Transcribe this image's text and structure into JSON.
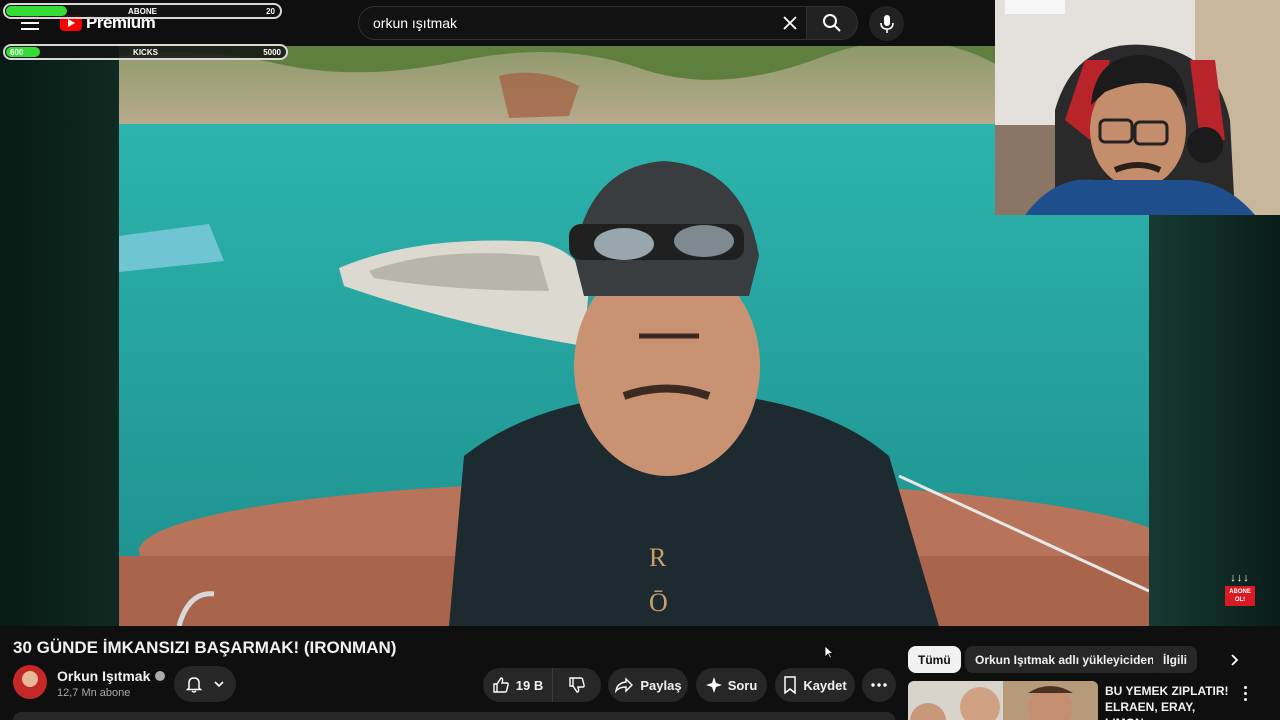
{
  "topbar": {
    "logo_text": "Premium",
    "search_query": "orkun ışıtmak"
  },
  "overlay": {
    "abone": {
      "left": "",
      "label": "ABONE",
      "right": "20",
      "fill_fraction": 0.22
    },
    "kicks": {
      "left": "600",
      "label": "KICKS",
      "right": "5000",
      "fill_fraction": 0.12
    }
  },
  "subscribe_badge": {
    "arrows": "↓↓↓",
    "line1": "ABONE",
    "line2": "OL!"
  },
  "video": {
    "title": "30 GÜNDE İMKANSIZI BAŞARMAK! (IRONMAN)",
    "channel": "Orkun Işıtmak",
    "subscribers": "12,7 Mn abone"
  },
  "actions": {
    "likes": "19 B",
    "share": "Paylaş",
    "ask": "Soru",
    "save": "Kaydet"
  },
  "sidebar": {
    "chips": [
      "Tümü",
      "Orkun Işıtmak adlı yükleyiciden",
      "İlgili"
    ],
    "recommendation": {
      "title": "BU YEMEK ZIPLATIR! ELRAEN, ERAY, LIMON,..."
    }
  },
  "colors": {
    "background": "#0f0f0f",
    "accent": "#ff0000",
    "progress_green": "#33dd33",
    "chip_bg": "#272727"
  }
}
